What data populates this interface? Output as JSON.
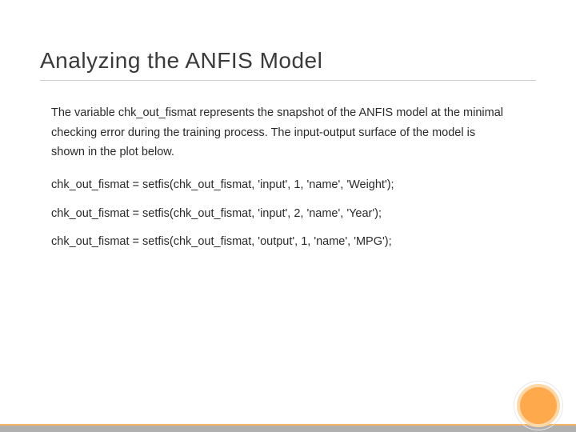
{
  "title": "Analyzing the ANFIS Model",
  "paragraph": "The variable chk_out_fismat represents the snapshot of the ANFIS model at the minimal checking error during the training process. The input-output surface of the model is shown in the plot below.",
  "code": {
    "line1": "chk_out_fismat = setfis(chk_out_fismat, 'input', 1, 'name', 'Weight');",
    "line2": "chk_out_fismat = setfis(chk_out_fismat, 'input', 2, 'name', 'Year');",
    "line3": "chk_out_fismat = setfis(chk_out_fismat, 'output', 1, 'name', 'MPG');"
  }
}
